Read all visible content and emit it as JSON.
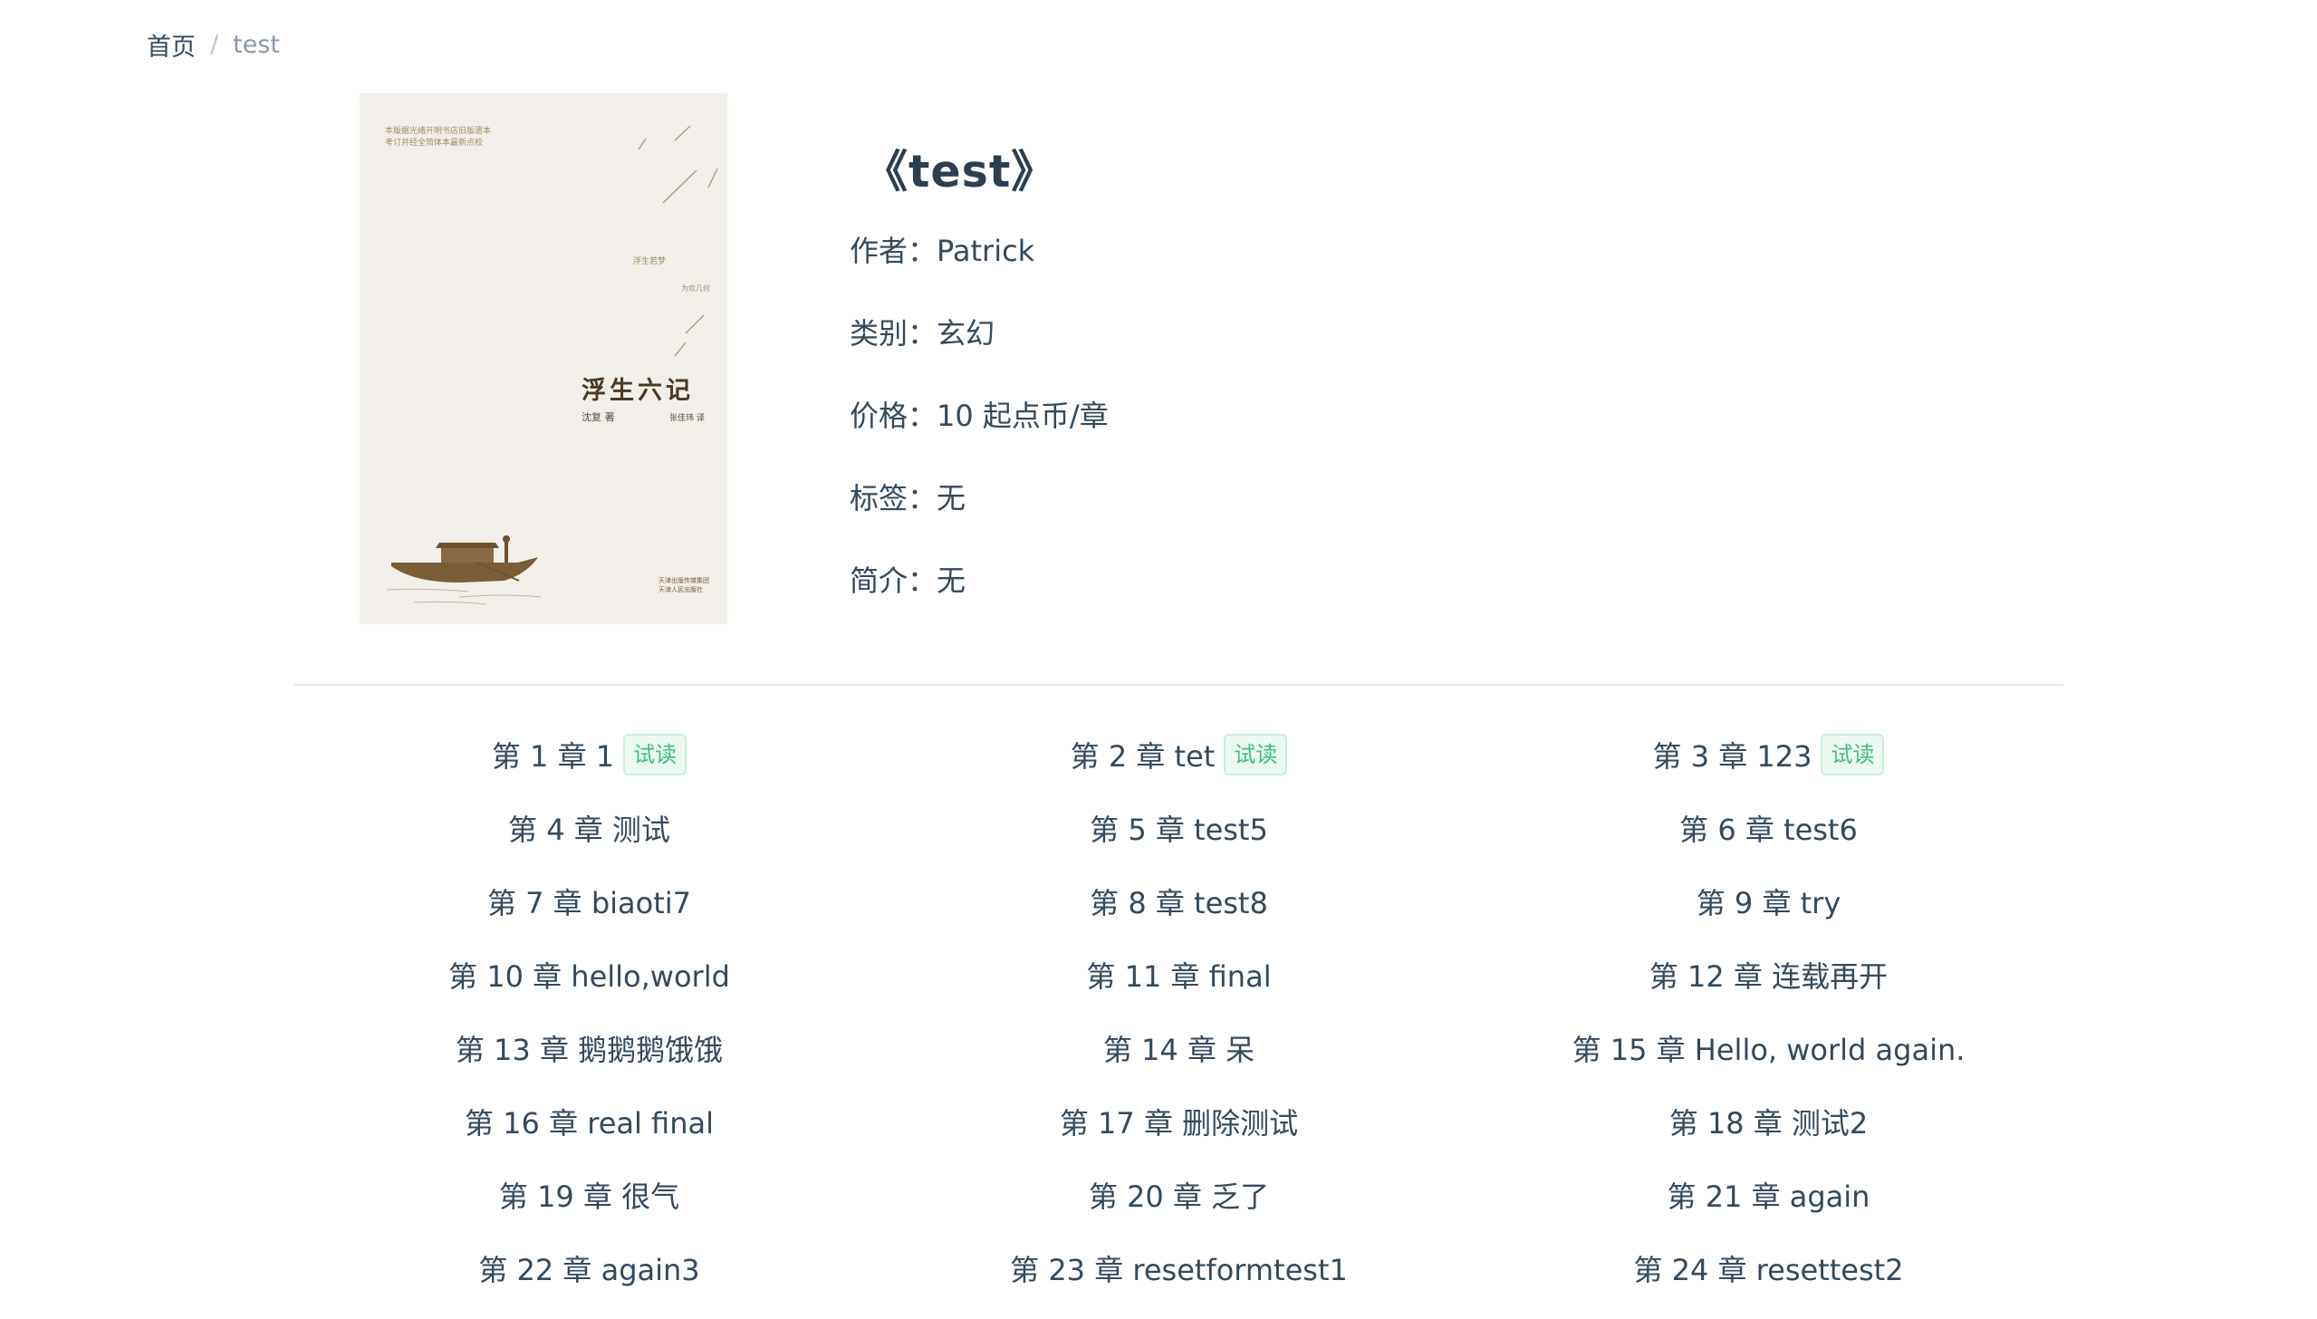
{
  "breadcrumb": {
    "home": "首页",
    "separator": "/",
    "current": "test"
  },
  "book": {
    "title": "《test》",
    "author_label": "作者：",
    "author": "Patrick",
    "category_label": "类别：",
    "category": "玄幻",
    "price_label": "价格：",
    "price": "10 起点币/章",
    "tags_label": "标签：",
    "tags": "无",
    "intro_label": "简介：",
    "intro": "无"
  },
  "cover": {
    "title": "浮生六记",
    "author": "沈复 著",
    "translator": "张佳玮 译",
    "top_line1": "本版据光绪开明书店旧版遗本",
    "top_line2": "考订并经全简体本最新点校",
    "side1": "浮生若梦",
    "side2": "为欢几何",
    "publisher1": "天津出版传媒集团",
    "publisher2": "天津人民出版社"
  },
  "trial_label": "试读",
  "chapters": [
    {
      "label": "第 1 章 1",
      "trial": true
    },
    {
      "label": "第 2 章 tet",
      "trial": true
    },
    {
      "label": "第 3 章 123",
      "trial": true
    },
    {
      "label": "第 4 章 测试",
      "trial": false
    },
    {
      "label": "第 5 章 test5",
      "trial": false
    },
    {
      "label": "第 6 章 test6",
      "trial": false
    },
    {
      "label": "第 7 章 biaoti7",
      "trial": false
    },
    {
      "label": "第 8 章 test8",
      "trial": false
    },
    {
      "label": "第 9 章 try",
      "trial": false
    },
    {
      "label": "第 10 章 hello,world",
      "trial": false
    },
    {
      "label": "第 11 章 final",
      "trial": false
    },
    {
      "label": "第 12 章 连载再开",
      "trial": false
    },
    {
      "label": "第 13 章 鹅鹅鹅饿饿",
      "trial": false
    },
    {
      "label": "第 14 章 呆",
      "trial": false
    },
    {
      "label": "第 15 章 Hello, world again.",
      "trial": false
    },
    {
      "label": "第 16 章 real final",
      "trial": false
    },
    {
      "label": "第 17 章 删除测试",
      "trial": false
    },
    {
      "label": "第 18 章 测试2",
      "trial": false
    },
    {
      "label": "第 19 章 很气",
      "trial": false
    },
    {
      "label": "第 20 章 乏了",
      "trial": false
    },
    {
      "label": "第 21 章 again",
      "trial": false
    },
    {
      "label": "第 22 章 again3",
      "trial": false
    },
    {
      "label": "第 23 章 resetformtest1",
      "trial": false
    },
    {
      "label": "第 24 章 resettest2",
      "trial": false
    }
  ]
}
